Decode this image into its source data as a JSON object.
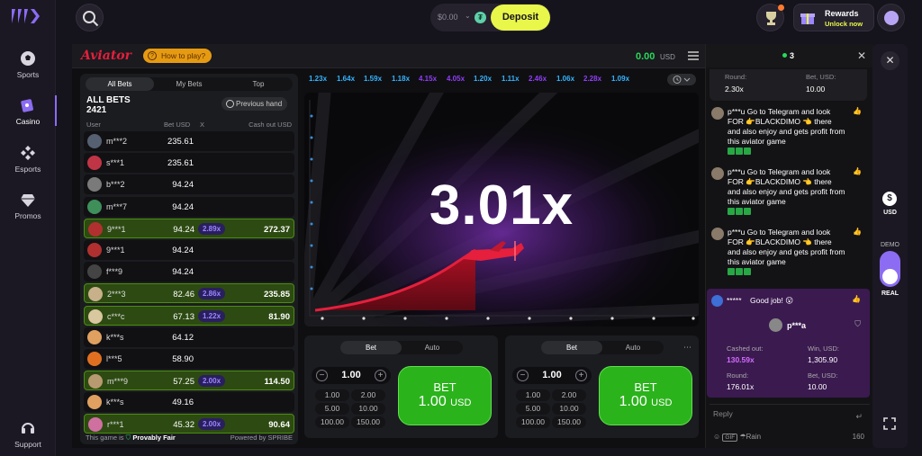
{
  "nav": {
    "items": [
      {
        "label": "Sports",
        "icon": "soccer-ball-icon"
      },
      {
        "label": "Casino",
        "icon": "casino-chip-icon"
      },
      {
        "label": "Esports",
        "icon": "gamepad-icon"
      },
      {
        "label": "Promos",
        "icon": "diamond-icon"
      }
    ],
    "support_label": "Support"
  },
  "topbar": {
    "balance": "$0.00",
    "coin_symbol": "₮",
    "deposit_label": "Deposit",
    "rewards_label": "Rewards",
    "rewards_sub": "Unlock now"
  },
  "game": {
    "logo": "Aviator",
    "how_to_play": "How to play?",
    "balance": "0.00",
    "currency": "USD",
    "multiplier": "3.01x",
    "history": [
      "1.23x",
      "1.64x",
      "1.59x",
      "1.18x",
      "4.15x",
      "4.05x",
      "1.20x",
      "1.11x",
      "2.46x",
      "1.06x",
      "2.28x",
      "1.09x"
    ],
    "history_colors": [
      "#34b4ff",
      "#34b4ff",
      "#34b4ff",
      "#34b4ff",
      "#913ef8",
      "#913ef8",
      "#34b4ff",
      "#34b4ff",
      "#913ef8",
      "#34b4ff",
      "#913ef8",
      "#34b4ff"
    ]
  },
  "bets": {
    "tabs": [
      "All Bets",
      "My Bets",
      "Top"
    ],
    "title": "ALL BETS",
    "count": "2421",
    "previous_hand": "Previous hand",
    "columns": {
      "user": "User",
      "bet": "Bet USD",
      "x": "X",
      "cashout": "Cash out USD"
    },
    "rows": [
      {
        "user": "m***2",
        "bet": "235.61",
        "mult": "",
        "cashout": "",
        "win": false,
        "avatar": "#556070"
      },
      {
        "user": "s***1",
        "bet": "235.61",
        "mult": "",
        "cashout": "",
        "win": false,
        "avatar": "#c03545"
      },
      {
        "user": "b***2",
        "bet": "94.24",
        "mult": "",
        "cashout": "",
        "win": false,
        "avatar": "#7a7a7a"
      },
      {
        "user": "m***7",
        "bet": "94.24",
        "mult": "",
        "cashout": "",
        "win": false,
        "avatar": "#3f8f5a"
      },
      {
        "user": "9***1",
        "bet": "94.24",
        "mult": "2.89x",
        "cashout": "272.37",
        "win": true,
        "avatar": "#b03030"
      },
      {
        "user": "9***1",
        "bet": "94.24",
        "mult": "",
        "cashout": "",
        "win": false,
        "avatar": "#b03030"
      },
      {
        "user": "f***9",
        "bet": "94.24",
        "mult": "",
        "cashout": "",
        "win": false,
        "avatar": "#444"
      },
      {
        "user": "2***3",
        "bet": "82.46",
        "mult": "2.86x",
        "cashout": "235.85",
        "win": true,
        "avatar": "#c8b08a"
      },
      {
        "user": "c***c",
        "bet": "67.13",
        "mult": "1.22x",
        "cashout": "81.90",
        "win": true,
        "avatar": "#d9c7a0"
      },
      {
        "user": "k***s",
        "bet": "64.12",
        "mult": "",
        "cashout": "",
        "win": false,
        "avatar": "#e0a060"
      },
      {
        "user": "l***5",
        "bet": "58.90",
        "mult": "",
        "cashout": "",
        "win": false,
        "avatar": "#e07020"
      },
      {
        "user": "m***9",
        "bet": "57.25",
        "mult": "2.00x",
        "cashout": "114.50",
        "win": true,
        "avatar": "#b89a70"
      },
      {
        "user": "k***s",
        "bet": "49.16",
        "mult": "",
        "cashout": "",
        "win": false,
        "avatar": "#e0a060"
      },
      {
        "user": "r***1",
        "bet": "45.32",
        "mult": "2.00x",
        "cashout": "90.64",
        "win": true,
        "avatar": "#d070a0"
      }
    ],
    "fair_prefix": "This game is",
    "fair_label": "Provably Fair",
    "powered": "Powered by SPRIBE"
  },
  "controls": {
    "panels": [
      {
        "tab_bet": "Bet",
        "tab_auto": "Auto",
        "amount": "1.00",
        "quick": [
          "1.00",
          "2.00",
          "5.00",
          "10.00",
          "100.00",
          "150.00"
        ],
        "bet_label": "BET",
        "bet_amount": "1.00",
        "bet_currency": "USD"
      },
      {
        "tab_bet": "Bet",
        "tab_auto": "Auto",
        "amount": "1.00",
        "quick": [
          "1.00",
          "2.00",
          "5.00",
          "10.00",
          "100.00",
          "150.00"
        ],
        "bet_label": "BET",
        "bet_amount": "1.00",
        "bet_currency": "USD"
      }
    ]
  },
  "chat": {
    "online": "3",
    "round_card": {
      "round_label": "Round:",
      "round": "2.30x",
      "bet_label": "Bet, USD:",
      "bet": "10.00"
    },
    "messages": [
      {
        "text": "p***u Go to Telegram and look FOR 👉BLACKDIMO 👈 there and also enjoy and gets profit from this aviator game"
      },
      {
        "text": "p***u Go to Telegram and look FOR 👉BLACKDIMO 👈 there and also enjoy and gets profit from this aviator game"
      },
      {
        "text": "p***u Go to Telegram and look FOR 👉BLACKDIMO 👈 there and also enjoy and gets profit from this aviator game"
      }
    ],
    "win_card": {
      "author": "*****",
      "text": "Good job! 😮",
      "player": "p***a",
      "cashed_label": "Cashed out:",
      "cashed": "130.59x",
      "win_label": "Win, USD:",
      "win": "1,305.90",
      "round_label": "Round:",
      "round": "176.01x",
      "bet_label": "Bet, USD:",
      "bet": "10.00"
    },
    "reply_placeholder": "Reply",
    "rain_label": "Rain",
    "gif_label": "GIF",
    "char_count": "160"
  },
  "rail": {
    "currency": "USD",
    "demo_label": "DEMO",
    "real_label": "REAL"
  }
}
